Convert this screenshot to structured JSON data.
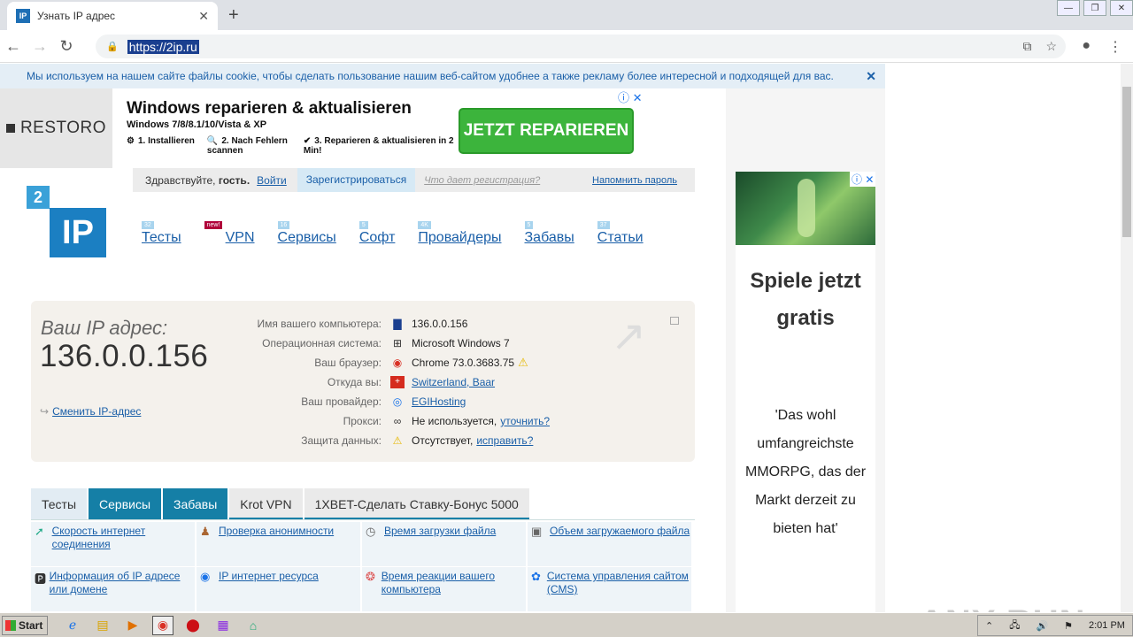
{
  "browser": {
    "tab_title": "Узнать IP адрес",
    "favicon_text": "IP",
    "url": "https://2ip.ru"
  },
  "cookie_bar": {
    "text": "Мы используем на нашем сайте файлы cookie, чтобы сделать пользование нашим веб-сайтом удобнее а также рекламу более интересной и подходящей для вас."
  },
  "top_ad": {
    "logo": "RESTORO",
    "title": "Windows reparieren & aktualisieren",
    "subtitle": "Windows 7/8/8.1/10/Vista & XP",
    "step1": "1. Installieren",
    "step2": "2. Nach Fehlern scannen",
    "step3": "3. Reparieren & aktualisieren in 2 Min!",
    "button": "JETZT REPARIEREN"
  },
  "login_bar": {
    "hello_prefix": "Здравствуйте, ",
    "hello_name": "гость",
    "login": "Войти",
    "register": "Зарегистрироваться",
    "what": "Что дает регистрация?",
    "remind": "Напомнить пароль"
  },
  "logo": {
    "small": "2",
    "big": "IP"
  },
  "nav": [
    {
      "label": "Тесты",
      "badge": "32"
    },
    {
      "label": "VPN",
      "badge": "new!"
    },
    {
      "label": "Сервисы",
      "badge": "16"
    },
    {
      "label": "Софт",
      "badge": "5"
    },
    {
      "label": "Провайдеры",
      "badge": "4K"
    },
    {
      "label": "Забавы",
      "badge": "5"
    },
    {
      "label": "Статьи",
      "badge": "37"
    }
  ],
  "ip_box": {
    "label": "Ваш IP адрес:",
    "ip": "136.0.0.156",
    "change": "Сменить IP-адрес",
    "rows": [
      {
        "key": "Имя вашего компьютера:",
        "value": "136.0.0.156"
      },
      {
        "key": "Операционная система:",
        "value": "Microsoft Windows 7"
      },
      {
        "key": "Ваш браузер:",
        "value": "Chrome 73.0.3683.75"
      },
      {
        "key": "Откуда вы:",
        "value": "Switzerland, Baar"
      },
      {
        "key": "Ваш провайдер:",
        "value": "EGIHosting"
      },
      {
        "key": "Прокси:",
        "value": "Не используется,",
        "extra": "уточнить?"
      },
      {
        "key": "Защита данных:",
        "value": "Отсутствует,",
        "extra": "исправить?"
      }
    ]
  },
  "tabs": [
    "Тесты",
    "Сервисы",
    "Забавы",
    "Krot VPN",
    "1XBET-Сделать Ставку-Бонус 5000"
  ],
  "services": [
    "Скорость интернет соединения",
    "Проверка анонимности",
    "Время загрузки файла",
    "Объем загружаемого файла",
    "Информация об IP адресе или домене",
    "IP интернет ресурса",
    "Время реакции вашего компьютера",
    "Система управления сайтом (CMS)"
  ],
  "right_ad": {
    "headline": "Spiele jetzt gratis",
    "quote": "'Das wohl umfangreichste MMORPG, das der Markt derzeit zu bieten hat'"
  },
  "watermark": "ANY RUN",
  "taskbar": {
    "start": "Start",
    "clock": "2:01 PM"
  }
}
